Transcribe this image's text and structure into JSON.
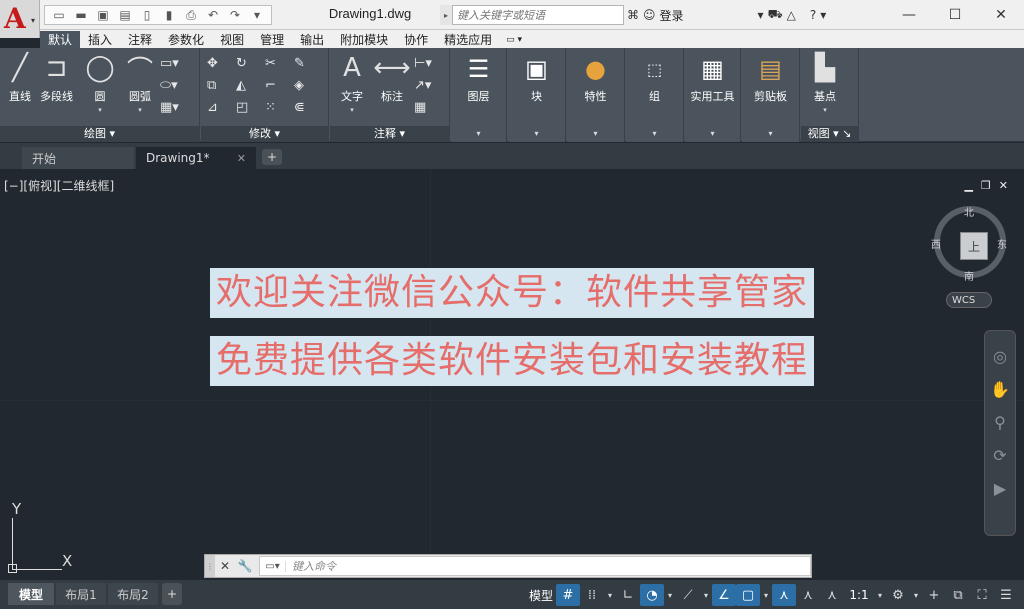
{
  "app": {
    "logo_letter": "A",
    "document_title": "Drawing1.dwg"
  },
  "search": {
    "placeholder": "键入关键字或短语"
  },
  "account": {
    "login": "登录"
  },
  "ribbon": {
    "tabs": [
      "默认",
      "插入",
      "注释",
      "参数化",
      "视图",
      "管理",
      "输出",
      "附加模块",
      "协作",
      "精选应用"
    ],
    "draw": {
      "title": "绘图",
      "line": "直线",
      "polyline": "多段线",
      "circle": "圆",
      "arc": "圆弧"
    },
    "modify": {
      "title": "修改"
    },
    "annotation": {
      "title": "注释",
      "text": "文字",
      "dimension": "标注"
    },
    "layers": "图层",
    "block": "块",
    "properties": "特性",
    "group": "组",
    "utilities": "实用工具",
    "clipboard": "剪贴板",
    "view": {
      "base": "基点",
      "title": "视图"
    }
  },
  "doc_tabs": {
    "start": "开始",
    "drawing": "Drawing1*"
  },
  "viewport": {
    "label": "[−][俯视][二维线框]"
  },
  "viewcube": {
    "north": "北",
    "south": "南",
    "east": "东",
    "west": "西",
    "face": "上",
    "wcs": "WCS"
  },
  "banner": {
    "line1": "欢迎关注微信公众号：软件共享管家",
    "line2": "免费提供各类软件安装包和安装教程"
  },
  "ucs": {
    "x": "X",
    "y": "Y"
  },
  "command": {
    "placeholder": "键入命令"
  },
  "layout_tabs": {
    "model": "模型",
    "layout1": "布局1",
    "layout2": "布局2"
  },
  "status": {
    "model": "模型",
    "scale": "1:1"
  }
}
